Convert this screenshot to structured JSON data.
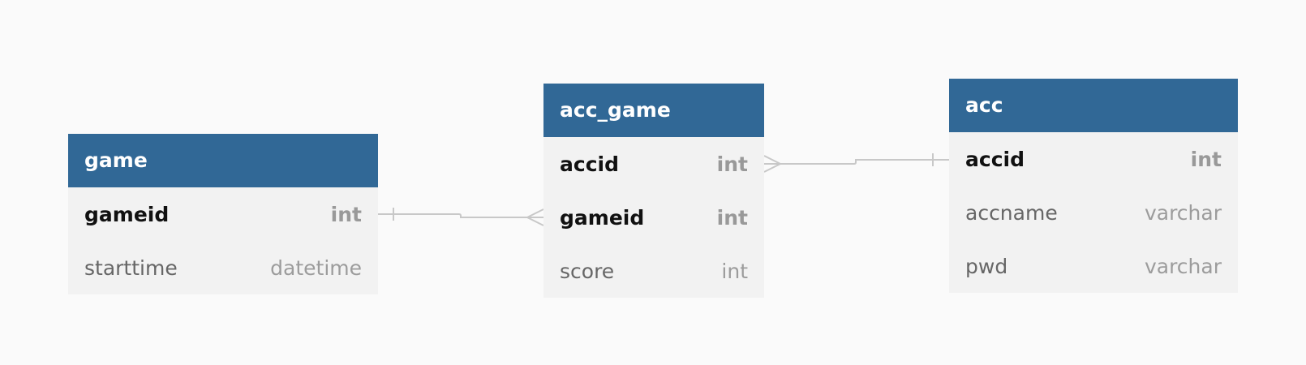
{
  "tables": {
    "game": {
      "name": "game",
      "fields": [
        {
          "name": "gameid",
          "type": "int"
        },
        {
          "name": "starttime",
          "type": "datetime"
        }
      ]
    },
    "acc_game": {
      "name": "acc_game",
      "fields": [
        {
          "name": "accid",
          "type": "int"
        },
        {
          "name": "gameid",
          "type": "int"
        },
        {
          "name": "score",
          "type": "int"
        }
      ]
    },
    "acc": {
      "name": "acc",
      "fields": [
        {
          "name": "accid",
          "type": "int"
        },
        {
          "name": "accname",
          "type": "varchar"
        },
        {
          "name": "pwd",
          "type": "varchar"
        }
      ]
    }
  },
  "relationships": [
    {
      "from": "game.gameid",
      "to": "acc_game.gameid",
      "from_cardinality": "one",
      "to_cardinality": "many"
    },
    {
      "from": "acc.accid",
      "to": "acc_game.accid",
      "from_cardinality": "one",
      "to_cardinality": "many"
    }
  ],
  "colors": {
    "background": "#fafafa",
    "header": "#316896",
    "body": "#f2f2f2",
    "connector": "#c8c8c8"
  }
}
